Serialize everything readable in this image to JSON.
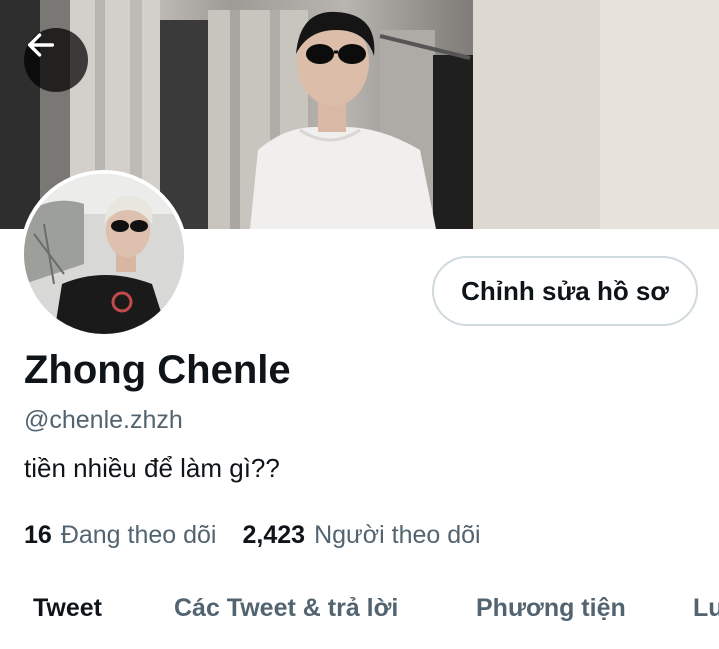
{
  "header": {
    "back_icon": "arrow-left-icon"
  },
  "profile": {
    "display_name": "Zhong Chenle",
    "handle": "@chenle.zhzh",
    "bio": "tiền nhiều để làm gì??",
    "edit_button_label": "Chỉnh sửa hồ sơ"
  },
  "stats": {
    "following_count": "16",
    "following_label": "Đang theo dõi",
    "followers_count": "2,423",
    "followers_label": "Người theo dõi"
  },
  "tabs": [
    {
      "label": "Tweet",
      "active": true
    },
    {
      "label": "Các Tweet & trả lời",
      "active": false
    },
    {
      "label": "Phương tiện",
      "active": false
    },
    {
      "label": "Lu",
      "active": false
    }
  ],
  "colors": {
    "text_primary": "#0f1419",
    "text_secondary": "#536471",
    "border": "#cfd9de"
  }
}
